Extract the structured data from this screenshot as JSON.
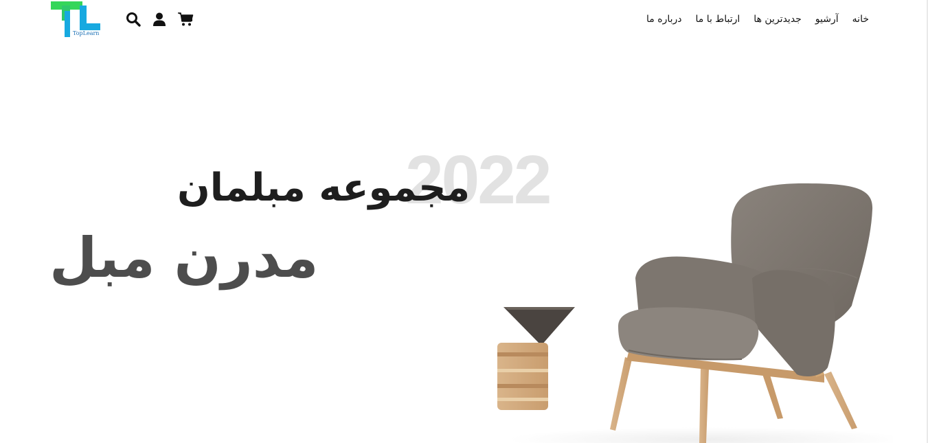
{
  "header": {
    "logo": {
      "brand_text": "TopLearn",
      "icon": "toplearn-logo"
    },
    "icons": [
      {
        "name": "cart-icon"
      },
      {
        "name": "user-icon"
      },
      {
        "name": "search-icon"
      }
    ],
    "nav": [
      {
        "label": "خانه"
      },
      {
        "label": "آرشیو"
      },
      {
        "label": "جدیدترین ها"
      },
      {
        "label": "ارتباط با ما"
      },
      {
        "label": "درباره ما"
      }
    ]
  },
  "hero": {
    "year": "2022",
    "title": "مجموعه مبلمان",
    "subtitle": "مدرن مبل",
    "image": "armchair-and-side-table"
  },
  "colors": {
    "logo_green": "#35d65a",
    "logo_blue": "#17a9e0",
    "heading_dark": "#1e1e1e",
    "heading_gray": "#4d4d4d",
    "year_light": "#e2e2e2"
  }
}
